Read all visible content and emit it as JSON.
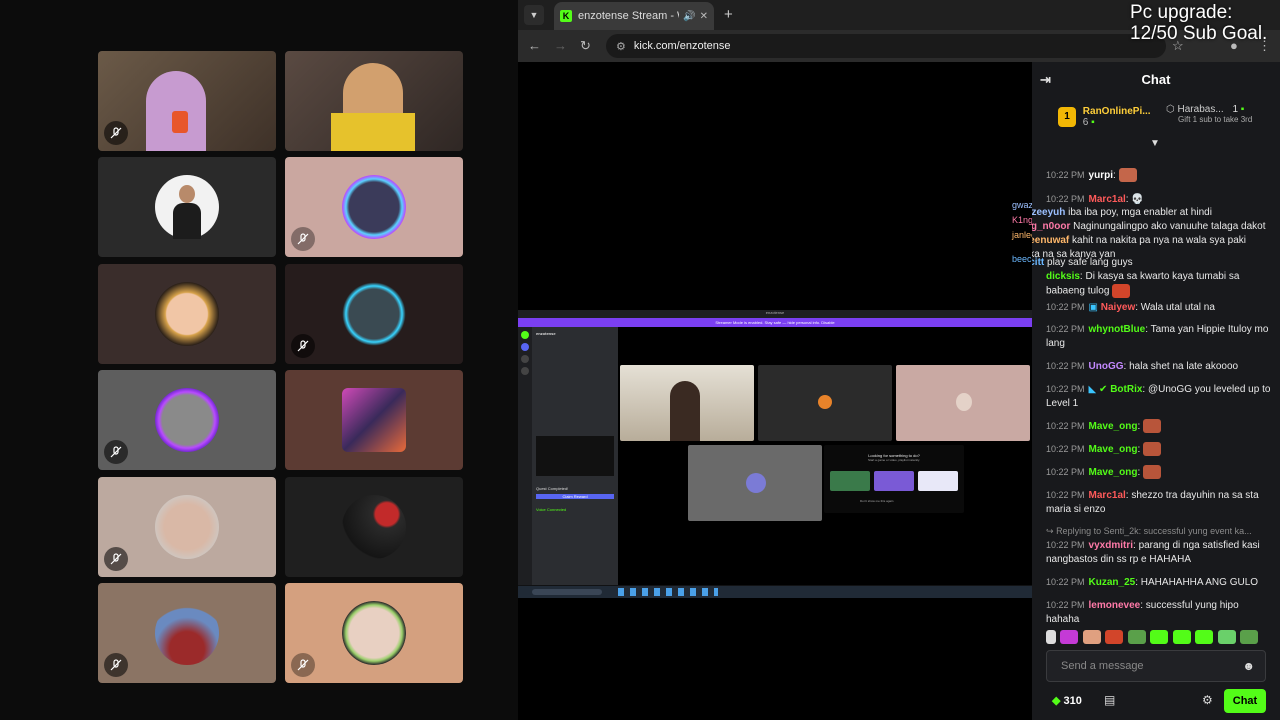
{
  "browser": {
    "tab_title": "enzotense Stream - Watch",
    "tab_favicon": "K",
    "url": "kick.com/enzotense"
  },
  "overlay": {
    "goal_line1": "Pc upgrade:",
    "goal_line2": "12/50 Sub Goal."
  },
  "call": {
    "tiles": [
      {
        "muted": true,
        "bg": "#5c4c3d",
        "avatar": "photo-webcam"
      },
      {
        "muted": false,
        "bg": "#4a3d38",
        "avatar": "photo-webcam"
      },
      {
        "muted": false,
        "bg": "#2a2a2a",
        "avatar": "avatar-bw"
      },
      {
        "muted": true,
        "bg": "#caa7a0",
        "avatar": "avatar-neon"
      },
      {
        "muted": false,
        "bg": "#3a2d2b",
        "avatar": "avatar-fox-hat"
      },
      {
        "muted": true,
        "bg": "#261c1c",
        "avatar": "avatar-neon-cyan"
      },
      {
        "muted": true,
        "bg": "#5e5e5e",
        "avatar": "avatar-bunny-purple"
      },
      {
        "muted": false,
        "bg": "#5c3b33",
        "avatar": "avatar-collage"
      },
      {
        "muted": true,
        "bg": "#bca99f",
        "avatar": "avatar-girl"
      },
      {
        "muted": false,
        "bg": "#1f1f1f",
        "avatar": "avatar-dark"
      },
      {
        "muted": true,
        "bg": "#8b7464",
        "avatar": "avatar-girl-red"
      },
      {
        "muted": true,
        "bg": "#d4a07f",
        "avatar": "avatar-girl-frame"
      }
    ]
  },
  "screenshare": {
    "title": "enzotense",
    "banner": "Streamer Mode is enabled. Stay safe — hide personal info.  Disable",
    "server_name": "enzotense",
    "quest": "Quest Completed!",
    "claim": "Claim Reward",
    "voice": "Voice Connected",
    "activity_title": "Looking for something to do?",
    "activity_sub": "Start a game or video, playlist instantly.",
    "checkbox_label": "Don't show me this again"
  },
  "chat": {
    "header": "Chat",
    "pinned_gifter": {
      "name": "RanOnlinePi...",
      "count": "6"
    },
    "pinned_second": {
      "name": "Harabas...",
      "count": "1",
      "note": "Gift 1 sub to take 3rd"
    },
    "messages": [
      {
        "time": "10:22 PM",
        "user": "yurpi",
        "color": "#ffffff",
        "text": ""
      },
      {
        "time": "10:22 PM",
        "user": "Marc1al",
        "color": "#ff5a5a",
        "text": ""
      },
      {
        "time": "10:22 PM",
        "user": "gwazeeyuh",
        "color": "#9cc0ff",
        "text": "iba iba poy, mga enabler at hindi"
      },
      {
        "time": "10:22 PM",
        "user": "K1ng_n0oor",
        "color": "#ff7aa8",
        "text": "Naginungalingpo ako vanuuhe talaga dakot"
      },
      {
        "time": "10:22 PM",
        "user": "janleenuwaf",
        "color": "#ffb86b",
        "text": "kahit na nakita pa nya na wala sya paki marka na sa kanya yan"
      },
      {
        "time": "10:22 PM",
        "user": "beecitt",
        "color": "#6bb8ff",
        "text": "play safe lang guys"
      },
      {
        "time": "10:22 PM",
        "user": "dicksis",
        "color": "#53fc18",
        "text": "Di kasya sa kwarto kaya tumabi sa babaeng tulog"
      },
      {
        "time": "10:22 PM",
        "user": "Naiyew",
        "color": "#ff5a5a",
        "text": "Wala utal utal na"
      },
      {
        "time": "10:22 PM",
        "user": "whynotBlue",
        "color": "#53fc18",
        "text": "Tama yan Hippie Ituloy mo lang"
      },
      {
        "time": "10:22 PM",
        "user": "UnoGG",
        "color": "#c48aff",
        "text": "hala shet na late akoooo"
      },
      {
        "time": "10:22 PM",
        "user": "BotRix",
        "color": "#53fc18",
        "text": "@UnoGG you leveled up to Level 1"
      },
      {
        "time": "10:22 PM",
        "user": "Mave_ong",
        "color": "#53fc18",
        "text": ""
      },
      {
        "time": "10:22 PM",
        "user": "Mave_ong",
        "color": "#53fc18",
        "text": ""
      },
      {
        "time": "10:22 PM",
        "user": "Mave_ong",
        "color": "#53fc18",
        "text": ""
      },
      {
        "time": "10:22 PM",
        "user": "Marc1al",
        "color": "#ff5a5a",
        "text": "shezzo tra dayuhin na sa sta maria si enzo"
      },
      {
        "time": "10:22 PM",
        "user": "vyxdmitri",
        "color": "#ff7aa8",
        "text": "parang di nga satisfied kasi nangbastos din ss rp e HAHAHA"
      },
      {
        "time": "10:22 PM",
        "user": "Kuzan_25",
        "color": "#53fc18",
        "text": "HAHAHAHHA ANG GULO"
      },
      {
        "time": "10:22 PM",
        "user": "lemonevee",
        "color": "#ff7aa8",
        "text": "successful yung hipo hahaha"
      }
    ],
    "reply_context": "Replying to Senti_2k: successful yung event ka...",
    "input_placeholder": "Send a message",
    "points": "310",
    "send_label": "Chat"
  },
  "colors": {
    "kick_green": "#53fc18",
    "chat_bg": "#18191c",
    "discord_purple": "#7b3ff2"
  }
}
